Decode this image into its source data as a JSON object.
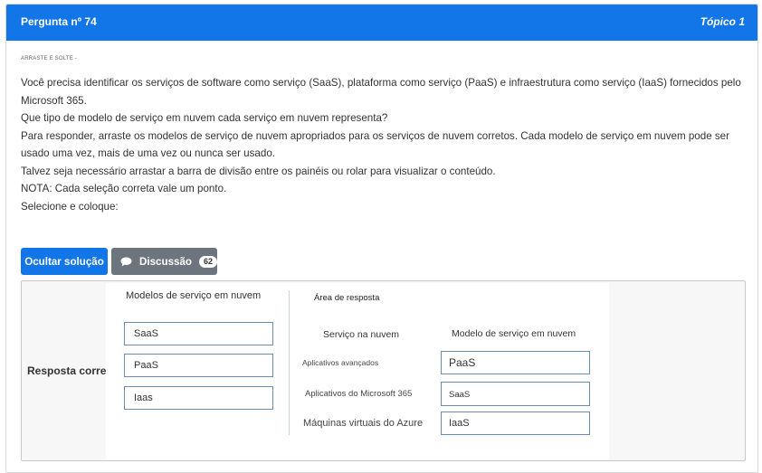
{
  "header": {
    "title": "Pergunta nº 74",
    "topic": "Tópico 1"
  },
  "question": {
    "tag": "ARRASTE E SOLTE -",
    "lines": [
      "Você precisa identificar os serviços de software como serviço (SaaS), plataforma como serviço (PaaS) e infraestrutura como serviço (IaaS) fornecidos pelo Microsoft 365.",
      "Que tipo de modelo de serviço em nuvem cada serviço em nuvem representa?",
      "Para responder, arraste os modelos de serviço de nuvem apropriados para os serviços de nuvem corretos. Cada modelo de serviço em nuvem pode ser usado uma vez, mais de uma vez ou nunca ser usado.",
      "Talvez seja necessário arrastar a barra de divisão entre os painéis ou rolar para visualizar o conteúdo.",
      "NOTA: Cada seleção correta vale um ponto.",
      "Selecione e coloque:"
    ]
  },
  "buttons": {
    "solution": "Ocultar solução",
    "discussion": "Discussão",
    "discussion_count": "62"
  },
  "answer": {
    "label": "Resposta correta:",
    "models_title": "Modelos de serviço em nuvem",
    "models": [
      "SaaS",
      "PaaS",
      "Iaas"
    ],
    "area_title": "Área de resposta",
    "col_service": "Serviço na nuvem",
    "col_model": "Modelo de serviço em nuvem",
    "rows": [
      {
        "service": "Aplicativos avançados",
        "model": "PaaS"
      },
      {
        "service": "Aplicativos do Microsoft 365",
        "model": "SaaS"
      },
      {
        "service": "Máquinas virtuais do Azure",
        "model": "IaaS"
      }
    ]
  },
  "colors": {
    "primary": "#1276e8",
    "secondary": "#6c757d",
    "box_border": "#6b8bb0"
  },
  "icons": {
    "discussion": "chat-bubble-icon"
  }
}
